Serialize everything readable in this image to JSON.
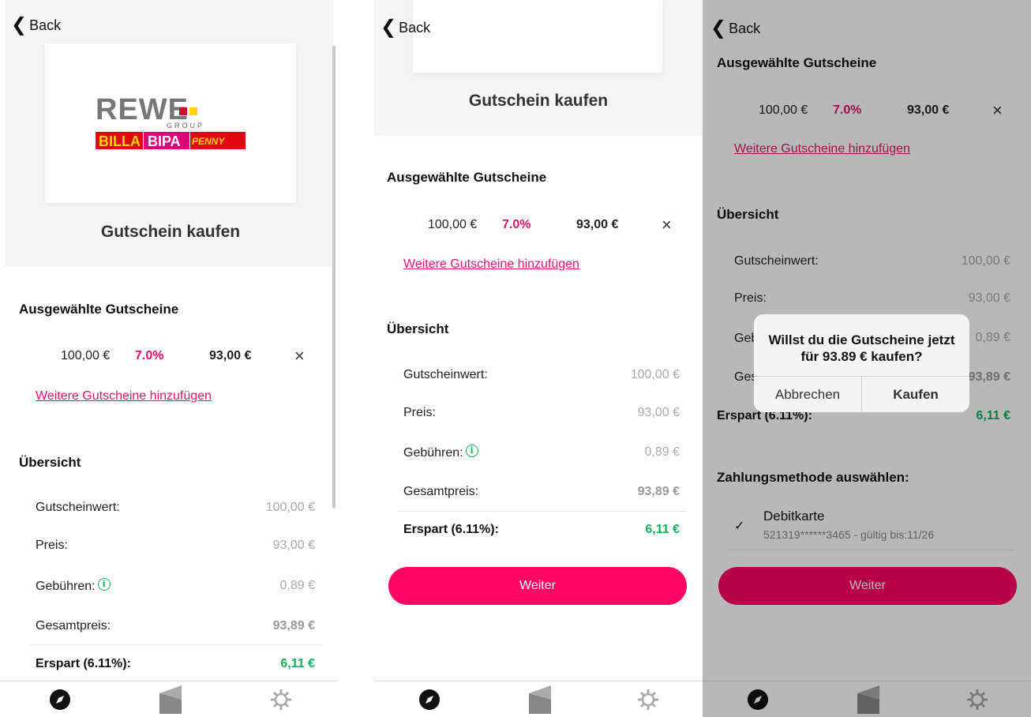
{
  "common": {
    "back_label": "Back",
    "page_title": "Gutschein kaufen",
    "selected_title": "Ausgewählte Gutscheine",
    "voucher": {
      "amount": "100,00 €",
      "discount": "7.0%",
      "price": "93,00 €",
      "remove_symbol": "×"
    },
    "add_more_link": "Weitere Gutscheine hinzufügen",
    "overview_title": "Übersicht",
    "overview": {
      "value_label": "Gutscheinwert:",
      "value": "100,00 €",
      "price_label": "Preis:",
      "price": "93,00 €",
      "fees_label": "Gebühren:",
      "fees": "0,89 €",
      "total_label": "Gesamtpreis:",
      "total": "93,89 €",
      "saved_label": "Erspart (6.11%):",
      "saved": "6,11 €"
    },
    "continue_button": "Weiter",
    "info_symbol": "i"
  },
  "logo": {
    "brand": "REWE",
    "group": "GROUP",
    "sub_brands": [
      "BILLA",
      "BIPA",
      "PENNY"
    ],
    "colors": {
      "rewe": "#c8102e",
      "billa": "#e30613",
      "bipa": "#e2007a",
      "penny": "#e30613",
      "yellow": "#ffd500",
      "orange": "#f39200"
    }
  },
  "payment": {
    "section_title": "Zahlungsmethode auswählen:",
    "method_name": "Debitkarte",
    "method_details": "521319******3465 - gültig bis:11/26",
    "check_symbol": "✓"
  },
  "dialog": {
    "message": "Willst du die Gutscheine jetzt für 93.89 € kaufen?",
    "cancel": "Abbrechen",
    "confirm": "Kaufen"
  },
  "tabs": [
    "explore-icon",
    "wallet-icon",
    "settings-icon"
  ],
  "colors": {
    "accent": "#ff0566",
    "link": "#e0166f",
    "discount": "#e5106a",
    "savings": "#12b15a"
  }
}
